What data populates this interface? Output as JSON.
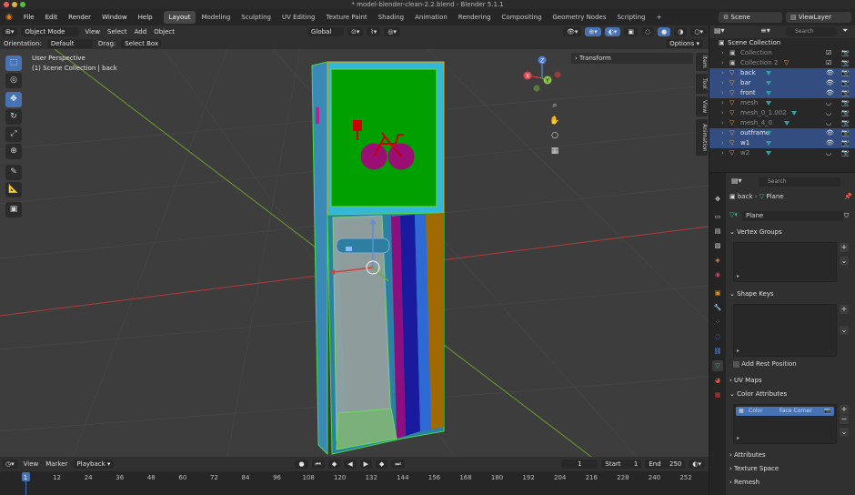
{
  "window_title": "* model-blender-clean-2.2.blend - Blender 5.1.1",
  "menu": [
    "File",
    "Edit",
    "Render",
    "Window",
    "Help"
  ],
  "workspaces": [
    "Layout",
    "Modeling",
    "Sculpting",
    "UV Editing",
    "Texture Paint",
    "Shading",
    "Animation",
    "Rendering",
    "Compositing",
    "Geometry Nodes",
    "Scripting"
  ],
  "active_workspace": "Layout",
  "add_workspace": "+",
  "scene_label": "Scene",
  "viewlayer_label": "ViewLayer",
  "header": {
    "mode": "Object Mode",
    "view": "View",
    "select": "Select",
    "add": "Add",
    "object": "Object",
    "transform_orientation": "Global",
    "orientation_label": "Orientation:",
    "orientation_value": "Default",
    "drag_label": "Drag:",
    "drag_value": "Select Box",
    "options": "Options"
  },
  "viewport": {
    "perspective": "User Perspective",
    "collection_info": "(1) Scene Collection | back",
    "transform_panel": "Transform",
    "side_tabs": [
      "Item",
      "Tool",
      "View",
      "Animation"
    ],
    "gizmo_axes": [
      "X",
      "Y",
      "Z"
    ]
  },
  "timeline": {
    "view": "View",
    "marker": "Marker",
    "playback": "Playback",
    "current_frame": "1",
    "start_label": "Start",
    "start": "1",
    "end_label": "End",
    "end": "250",
    "ticks": [
      "1",
      "12",
      "24",
      "36",
      "48",
      "60",
      "72",
      "84",
      "96",
      "108",
      "120",
      "132",
      "144",
      "156",
      "168",
      "180",
      "192",
      "204",
      "216",
      "228",
      "240",
      "252"
    ]
  },
  "outliner": {
    "search_placeholder": "Search",
    "root": "Scene Collection",
    "items": [
      {
        "name": "Collection",
        "selected": false,
        "dim": true
      },
      {
        "name": "Collection 2",
        "selected": false,
        "dim": true
      },
      {
        "name": "back",
        "selected": true,
        "dim": false
      },
      {
        "name": "bar",
        "selected": true,
        "dim": false
      },
      {
        "name": "front",
        "selected": true,
        "dim": false
      },
      {
        "name": "mesh",
        "selected": false,
        "dim": true
      },
      {
        "name": "mesh_0_1.002",
        "selected": false,
        "dim": true
      },
      {
        "name": "mesh_4_0",
        "selected": false,
        "dim": true
      },
      {
        "name": "outframe",
        "selected": true,
        "dim": false
      },
      {
        "name": "w1",
        "selected": true,
        "dim": false
      },
      {
        "name": "w2",
        "selected": false,
        "dim": true
      }
    ]
  },
  "properties": {
    "search_placeholder": "Search",
    "object_name": "back",
    "mesh_name": "Plane",
    "data_field": "Plane",
    "panels": {
      "vertex_groups": "Vertex Groups",
      "shape_keys": "Shape Keys",
      "add_rest_position": "Add Rest Position",
      "uv_maps": "UV Maps",
      "color_attributes": "Color Attributes",
      "attributes": "Attributes",
      "texture_space": "Texture Space",
      "remesh": "Remesh"
    },
    "color_attribute_item": "Color",
    "color_attribute_domain": "Face Corner"
  },
  "colors": {
    "accent": "#4772b3",
    "selected_row": "#334d80",
    "mesh_icon": "#30a0a0"
  }
}
